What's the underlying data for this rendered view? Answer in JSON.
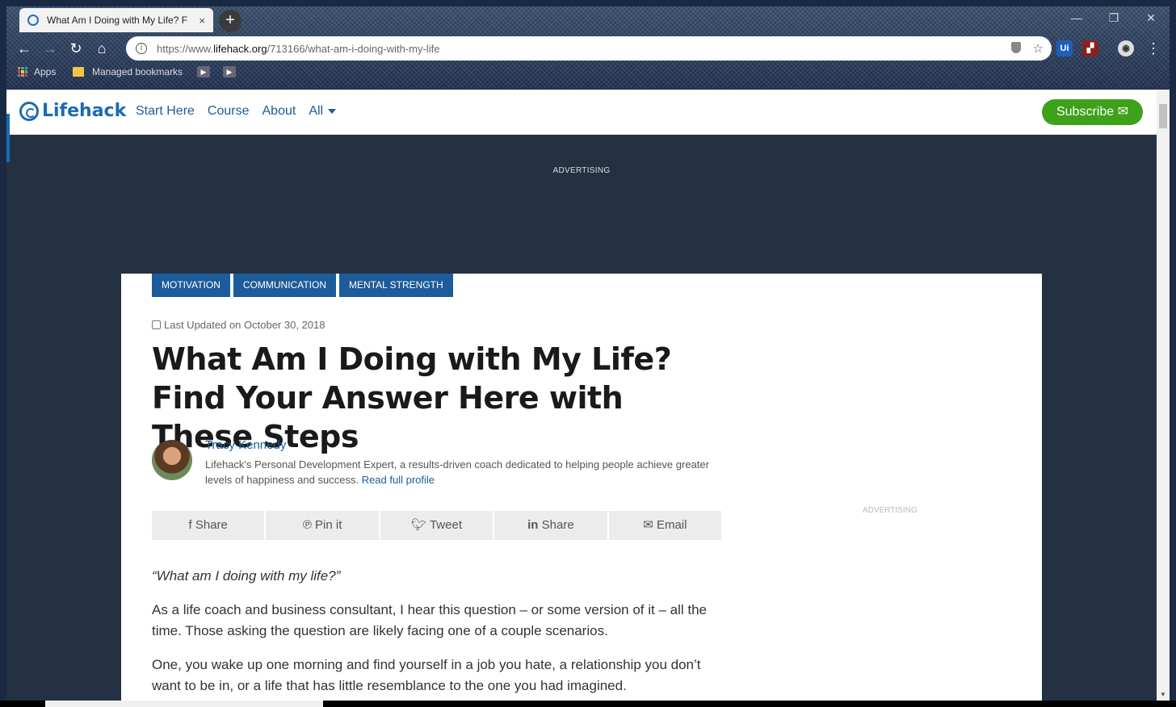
{
  "browser": {
    "tab_title": "What Am I Doing with My Life? F",
    "tab_close": "×",
    "new_tab": "+",
    "url_prefix": "https://www.",
    "url_domain": "lifehack.org",
    "url_path": "/713166/what-am-i-doing-with-my-life",
    "bookmarks": {
      "apps": "Apps",
      "managed": "Managed bookmarks"
    }
  },
  "site": {
    "logo": "Lifehack",
    "nav": [
      "Start Here",
      "Course",
      "About",
      "All"
    ],
    "subscribe": "Subscribe"
  },
  "ads": {
    "top_label": "ADVERTISING",
    "side_label": "ADVERTISING"
  },
  "article": {
    "categories": [
      "MOTIVATION",
      "COMMUNICATION",
      "MENTAL STRENGTH"
    ],
    "updated": "Last Updated on October 30, 2018",
    "headline": "What Am I Doing with My Life? Find Your Answer Here with These Steps",
    "author": {
      "name": "Tracy Kennedy",
      "bio": "Lifehack's Personal Development Expert, a results-driven coach dedicated to helping people achieve greater levels of happiness and success.",
      "read_more": "Read full profile"
    },
    "share": [
      "Share",
      "Pin it",
      "Tweet",
      "Share",
      "Email"
    ],
    "paragraphs": [
      "“What am I doing with my life?”",
      "As a life coach and business consultant, I hear this question – or some version of it – all the time. Those asking the question are likely facing one of a couple scenarios.",
      "One, you wake up one morning and find yourself in a job you hate, a relationship you don’t want to be in, or a life that has little resemblance to the one you had imagined."
    ]
  },
  "colors": {
    "brand_blue": "#1c6ab3",
    "subscribe_green": "#3ea11a",
    "hero_bg": "#243142"
  }
}
